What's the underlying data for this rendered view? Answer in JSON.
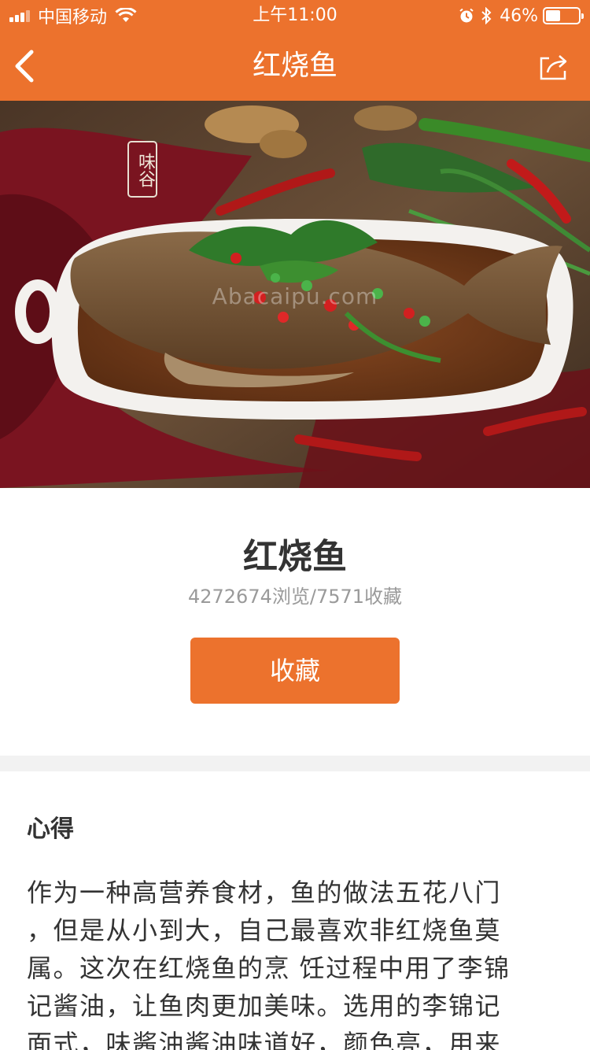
{
  "status_bar": {
    "carrier": "中国移动",
    "time": "上午11:00",
    "battery_percent": "46%",
    "battery_level": 0.46,
    "icons": [
      "signal-icon",
      "wifi-icon",
      "alarm-icon",
      "bluetooth-icon",
      "battery-icon"
    ]
  },
  "nav": {
    "title": "红烧鱼",
    "back_icon": "chevron-left-icon",
    "share_icon": "share-icon"
  },
  "hero": {
    "badge_text": "味谷",
    "watermark": "Abacaipu.com"
  },
  "recipe": {
    "title": "红烧鱼",
    "views": "4272674浏览",
    "separator": "/",
    "favorites": "7571收藏",
    "favorite_button_label": "收藏"
  },
  "section": {
    "title": "心得",
    "lines": [
      "作为一种高营养食材，鱼的做法五花八门",
      "，但是从小到大，自己最喜欢非红烧鱼莫",
      "属。这次在红烧鱼的烹 饪过程中用了李锦",
      "记酱油，让鱼肉更加美味。选用的李锦记",
      "面式，味酱油酱油味道好，颜色亮，用来"
    ]
  },
  "colors": {
    "accent": "#ec722d",
    "divider": "#f2f2f2",
    "muted_text": "#9a9a9a"
  }
}
